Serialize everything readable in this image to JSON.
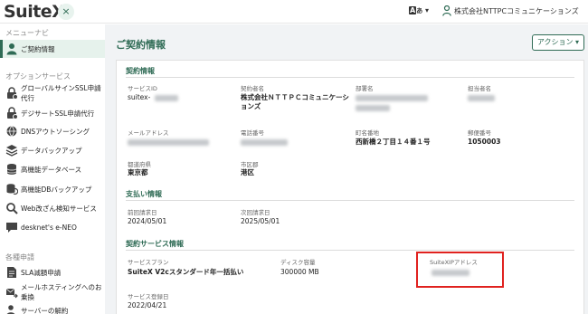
{
  "header": {
    "logo": "SuiteX",
    "close_icon": "×",
    "lang_label": "A",
    "lang_sub": "あ",
    "company": "株式会社NTTPCコミュニケーションズ"
  },
  "sidebar": {
    "menu_title": "メニューナビ",
    "active_item": "ご契約情報",
    "options_title": "オプションサービス",
    "options": [
      "グローバルサインSSL申請代行",
      "デジサートSSL申請代行",
      "DNSアウトソーシング",
      "データバックアップ",
      "高機能データベース",
      "高機能DBバックアップ",
      "Web改ざん検知サービス",
      "desknet's e-NEO"
    ],
    "requests_title": "各種申請",
    "requests": [
      "SLA減額申請",
      "メールホスティングへのお乗換",
      "サーバーの解約"
    ]
  },
  "main": {
    "title": "ご契約情報",
    "action_button": "アクション ▾",
    "contract": {
      "title": "契約情報",
      "service_id_label": "サービスID",
      "service_id_value": "suitex-",
      "contractor_label": "契約者名",
      "contractor_value": "株式会社ＮＴＴＰＣコミュニケーションズ",
      "dept_label": "部署名",
      "person_label": "担当者名",
      "person_value": "",
      "mail_label": "メールアドレス",
      "phone_label": "電話番号",
      "town_label": "町名番地",
      "town_value": "西新橋２丁目１４番１号",
      "zip_label": "郵便番号",
      "zip_value": "1050003",
      "pref_label": "都道府県",
      "pref_value": "東京都",
      "city_label": "市区郡",
      "city_value": "港区"
    },
    "payment": {
      "title": "支払い情報",
      "prev_label": "前回請求日",
      "prev_value": "2024/05/01",
      "next_label": "次回請求日",
      "next_value": "2025/05/01"
    },
    "service": {
      "title": "契約サービス情報",
      "plan_label": "サービスプラン",
      "plan_value": "SuiteX V2cスタンダード年一括払い",
      "disk_label": "ディスク容量",
      "disk_value": "300000 MB",
      "ip_label": "SuiteXIPアドレス",
      "reg_label": "サービス登録日",
      "reg_value": "2022/04/21"
    }
  },
  "colors": {
    "accent": "#2f6b55",
    "highlight": "#e0221f",
    "background": "#f1f3f5"
  }
}
